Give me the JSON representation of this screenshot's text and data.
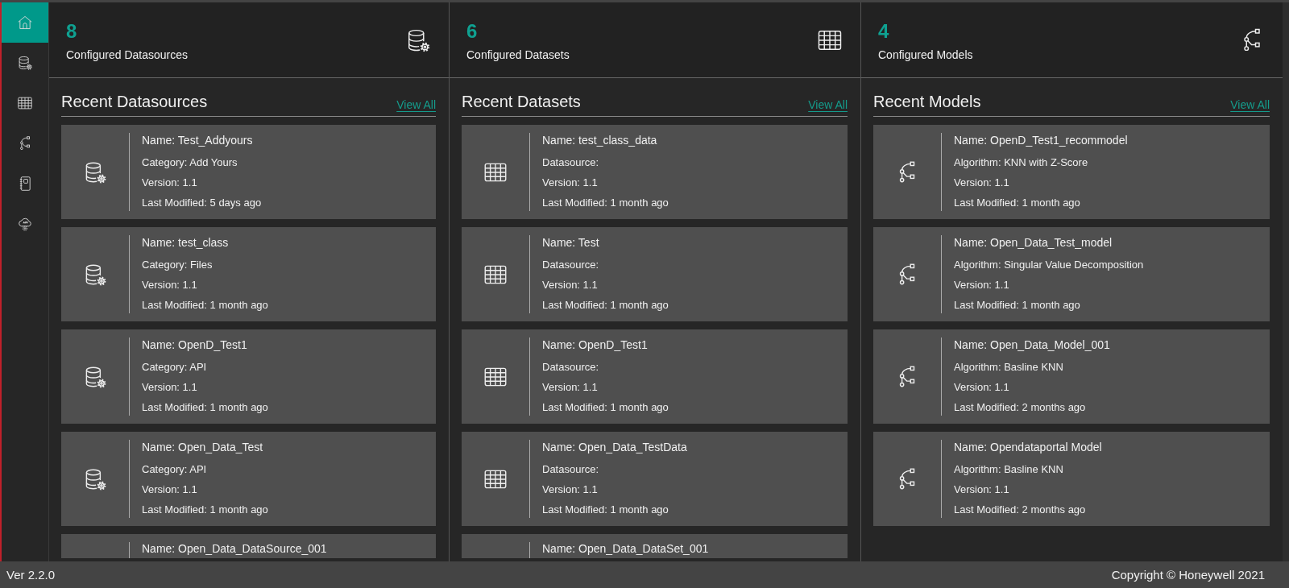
{
  "sidebar": {
    "items": [
      {
        "kind": "home",
        "selected": true
      },
      {
        "kind": "datasource",
        "selected": false
      },
      {
        "kind": "dataset",
        "selected": false
      },
      {
        "kind": "model",
        "selected": false
      },
      {
        "kind": "notebook",
        "selected": false
      },
      {
        "kind": "api",
        "selected": false
      }
    ]
  },
  "columns": [
    {
      "kind": "datasource",
      "count": "8",
      "label": "Configured Datasources",
      "title": "Recent Datasources",
      "view_all": "View All",
      "cards": [
        {
          "lines": [
            "Name: Test_Addyours",
            "Category: Add Yours",
            "Version: 1.1",
            "Last Modified: 5 days ago"
          ]
        },
        {
          "lines": [
            "Name: test_class",
            "Category: Files",
            "Version: 1.1",
            "Last Modified: 1 month ago"
          ]
        },
        {
          "lines": [
            "Name: OpenD_Test1",
            "Category: API",
            "Version: 1.1",
            "Last Modified: 1 month ago"
          ]
        },
        {
          "lines": [
            "Name: Open_Data_Test",
            "Category: API",
            "Version: 1.1",
            "Last Modified: 1 month ago"
          ]
        },
        {
          "lines": [
            "Name: Open_Data_DataSource_001"
          ]
        }
      ]
    },
    {
      "kind": "dataset",
      "count": "6",
      "label": "Configured Datasets",
      "title": "Recent Datasets",
      "view_all": "View All",
      "cards": [
        {
          "lines": [
            "Name: test_class_data",
            "Datasource:",
            "Version: 1.1",
            "Last Modified: 1 month ago"
          ]
        },
        {
          "lines": [
            "Name: Test",
            "Datasource:",
            "Version: 1.1",
            "Last Modified: 1 month ago"
          ]
        },
        {
          "lines": [
            "Name: OpenD_Test1",
            "Datasource:",
            "Version: 1.1",
            "Last Modified: 1 month ago"
          ]
        },
        {
          "lines": [
            "Name: Open_Data_TestData",
            "Datasource:",
            "Version: 1.1",
            "Last Modified: 1 month ago"
          ]
        },
        {
          "lines": [
            "Name: Open_Data_DataSet_001"
          ]
        }
      ]
    },
    {
      "kind": "model",
      "count": "4",
      "label": "Configured Models",
      "title": "Recent Models",
      "view_all": "View All",
      "cards": [
        {
          "lines": [
            "Name: OpenD_Test1_recommodel",
            "Algorithm: KNN with Z-Score",
            "Version: 1.1",
            "Last Modified: 1 month ago"
          ]
        },
        {
          "lines": [
            "Name: Open_Data_Test_model",
            "Algorithm: Singular Value Decomposition",
            "Version: 1.1",
            "Last Modified: 1 month ago"
          ]
        },
        {
          "lines": [
            "Name: Open_Data_Model_001",
            "Algorithm: Basline KNN",
            "Version: 1.1",
            "Last Modified: 2 months ago"
          ]
        },
        {
          "lines": [
            "Name: Opendataportal Model",
            "Algorithm: Basline KNN",
            "Version: 1.1",
            "Last Modified: 2 months ago"
          ]
        }
      ]
    }
  ],
  "footer": {
    "version": "Ver 2.2.0",
    "copyright": "Copyright © Honeywell 2021"
  }
}
